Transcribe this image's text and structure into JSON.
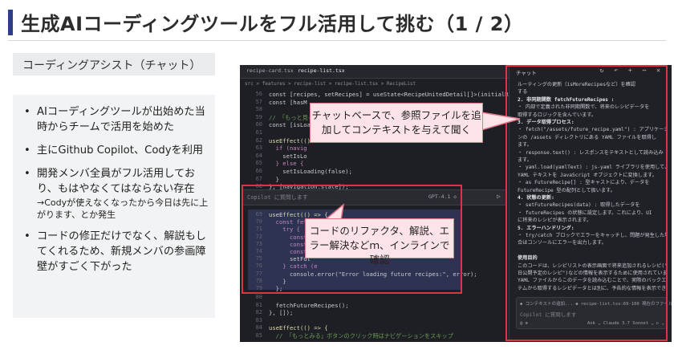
{
  "title": "生成AIコーディングツールをフル活用して挑む（1 / 2）",
  "section_label": "コーディングアシスト（チャット）",
  "bullets": [
    {
      "text": "AIコーディングツールが出始めた当時からチームで活用を始めた"
    },
    {
      "text": "主にGithub Copilot、Codyを利用"
    },
    {
      "text": "開発メンバ全員がフル活用しており、もはやなくてはならない存在",
      "sub": "→Codyが使えなくなったから今日は先に上がります、とか発生"
    },
    {
      "text": "コードの修正だけでなく、解説もしてくれるため、新規メンバの参画障壁がすごく下がった"
    }
  ],
  "callouts": {
    "chat": "チャットベースで、参照ファイルを追加してコンテキストを与えて聞く",
    "inline": "コードのリファクタ、解説、エラー解決などｍ、インラインで確認"
  },
  "editor": {
    "tabs": [
      "recipe-card.tsx",
      "recipe-list.tsx"
    ],
    "breadcrumb": "src > features > recipe-list > recipe-list.tsx > RecipeList",
    "lines": [
      {
        "n": "56",
        "code": "const [recipes, setRecipes] = useState<RecipeUnitedDetail[]>(initialRecipes);",
        "cls": ""
      },
      {
        "n": "57",
        "code": "const [hasM",
        "cls": ""
      },
      {
        "n": "58",
        "code": "",
        "cls": ""
      },
      {
        "n": "59",
        "code": "// 「もっと見る",
        "cls": "cm"
      },
      {
        "n": "60",
        "code": "const [isLoa",
        "cls": ""
      },
      {
        "n": "61",
        "code": "",
        "cls": ""
      },
      {
        "n": "62",
        "code": "useEffect(()",
        "cls": "fn"
      },
      {
        "n": "63",
        "code": "  if (navig",
        "cls": "kw"
      },
      {
        "n": "64",
        "code": "    setIsLo",
        "cls": ""
      },
      {
        "n": "65",
        "code": "  } else {",
        "cls": "kw"
      },
      {
        "n": "66",
        "code": "    setIsLoading(false);",
        "cls": ""
      },
      {
        "n": "67",
        "code": "  }",
        "cls": ""
      },
      {
        "n": "68",
        "code": "}, [navigation.state]);",
        "cls": ""
      }
    ],
    "inline_placeholder": "Copilot に質問します",
    "inline_model": "GPT-4.1 ◇",
    "selected_lines": [
      {
        "n": "69",
        "code": "useEffect(() => {",
        "cls": "fn"
      },
      {
        "n": "70",
        "code": "  const fetchF",
        "cls": "kw"
      },
      {
        "n": "71",
        "code": "    try {",
        "cls": "kw"
      },
      {
        "n": "72",
        "code": "      const",
        "cls": "kw"
      },
      {
        "n": "73",
        "code": "      const",
        "cls": "kw"
      },
      {
        "n": "74",
        "code": "      const",
        "cls": "kw"
      },
      {
        "n": "75",
        "code": "      setFut",
        "cls": ""
      },
      {
        "n": "76",
        "code": "    } catch (e",
        "cls": "kw"
      },
      {
        "n": "77",
        "code": "      console.error(\"Error loading future recipes:\", error);",
        "cls": ""
      },
      {
        "n": "78",
        "code": "    }",
        "cls": ""
      },
      {
        "n": "79",
        "code": "  };",
        "cls": ""
      }
    ],
    "tail_lines": [
      {
        "n": "80",
        "code": "",
        "cls": ""
      },
      {
        "n": "81",
        "code": "  fetchFutureRecipes();",
        "cls": ""
      },
      {
        "n": "82",
        "code": "}, []);",
        "cls": ""
      },
      {
        "n": "83",
        "code": "",
        "cls": ""
      },
      {
        "n": "84",
        "code": "useEffect(() => {",
        "cls": "fn"
      },
      {
        "n": "85",
        "code": "  // 「もっとみる」ボタンのクリック時はナビゲーションをスキップ",
        "cls": "cm"
      }
    ]
  },
  "chat_panel": {
    "tab": "チャット",
    "icons": "↻ ↶ + ⋯ ✕",
    "lines": [
      {
        "t": "ルーティングの更新（isMoreRecipesなど）を確認",
        "head": false
      },
      {
        "t": "する",
        "head": false
      },
      {
        "t": "2. 非同期関数 fetchFutureRecipes :",
        "head": true
      },
      {
        "t": "・ 内部で定義された非同期関数で、将来のレシピデータを",
        "head": false
      },
      {
        "t": "   取得するロジックを含んでいます。",
        "head": false
      },
      {
        "t": "3. データ取得プロセス:",
        "head": true
      },
      {
        "t": "・ fetch(\"/assets/future_recipe.yaml\") : アプリケーショ",
        "head": false
      },
      {
        "t": "   ンの /assets ディレクトリにある YAML ファイルを取得し",
        "head": false
      },
      {
        "t": "   ます。",
        "head": false
      },
      {
        "t": "・ response.text() : レスポンスをテキストとして読み込み",
        "head": false
      },
      {
        "t": "   ます。",
        "head": false
      },
      {
        "t": "・ yaml.load(yamlText) : js-yaml ライブラリを使用して、",
        "head": false
      },
      {
        "t": "   YAML テキストを JavaScript オブジェクトに変換します。",
        "head": false
      },
      {
        "t": "・ as FutureRecipe[] : 型キャストにより、データを",
        "head": false
      },
      {
        "t": "   FutureRecipe 型の配列として扱います。",
        "head": false
      },
      {
        "t": "4. 状態の更新:",
        "head": true
      },
      {
        "t": "・ setFutureRecipes(data) : 取得したデータを",
        "head": false
      },
      {
        "t": "・ futureRecipes の状態に設定します。これにより、UI",
        "head": false
      },
      {
        "t": "   に将来のレシピが表示されます。",
        "head": false
      },
      {
        "t": "5. エラーハンドリング:",
        "head": true
      },
      {
        "t": "・ try/catch ブロックでエラーをキャッチし、問題が発生した場",
        "head": false
      },
      {
        "t": "   合はコンソールにエラーを出力します。",
        "head": false
      },
      {
        "t": "",
        "head": false
      },
      {
        "t": "使用目的",
        "head": true
      },
      {
        "t": "このコードは、レシピリストの表示画面で将来追加されるレシピ(\"近",
        "head": false
      },
      {
        "t": "日公開予定のレシピ\")などの情報を表示するために使用されています。",
        "head": false
      },
      {
        "t": "YAML ファイルからこのデータを読み込むことで、実際のバックエンドシス",
        "head": false
      },
      {
        "t": "テムから取得するレシピデータとは別に、予告的な情報を表示できます。",
        "head": false
      }
    ],
    "context_label": "◆ コンテキストの追加...   ◆ recipe-list.tsx:69-100  現在のファイル",
    "placeholder": "Copilot に質問します",
    "footer_left": "@  ⊕",
    "footer_right": "Ask ⌄   Claude 3.7 Sonnet ⌄   ▷ ⌄"
  }
}
